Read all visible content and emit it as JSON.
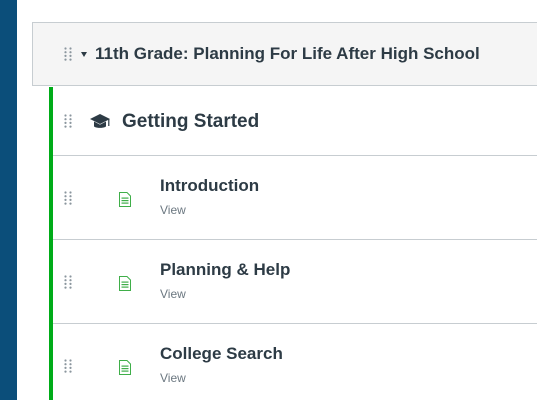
{
  "module": {
    "title": "11th Grade: Planning For Life After High School"
  },
  "sub_header": {
    "title": "Getting Started",
    "icon": "graduation-cap-icon"
  },
  "items": [
    {
      "title": "Introduction",
      "subtitle": "View",
      "icon": "page-icon"
    },
    {
      "title": "Planning & Help",
      "subtitle": "View",
      "icon": "page-icon"
    },
    {
      "title": "College Search",
      "subtitle": "View",
      "icon": "page-icon"
    }
  ],
  "colors": {
    "background": "#0b4e7a",
    "accent_border": "#00ac18",
    "page_icon": "#3fae49",
    "text": "#2d3b45"
  }
}
